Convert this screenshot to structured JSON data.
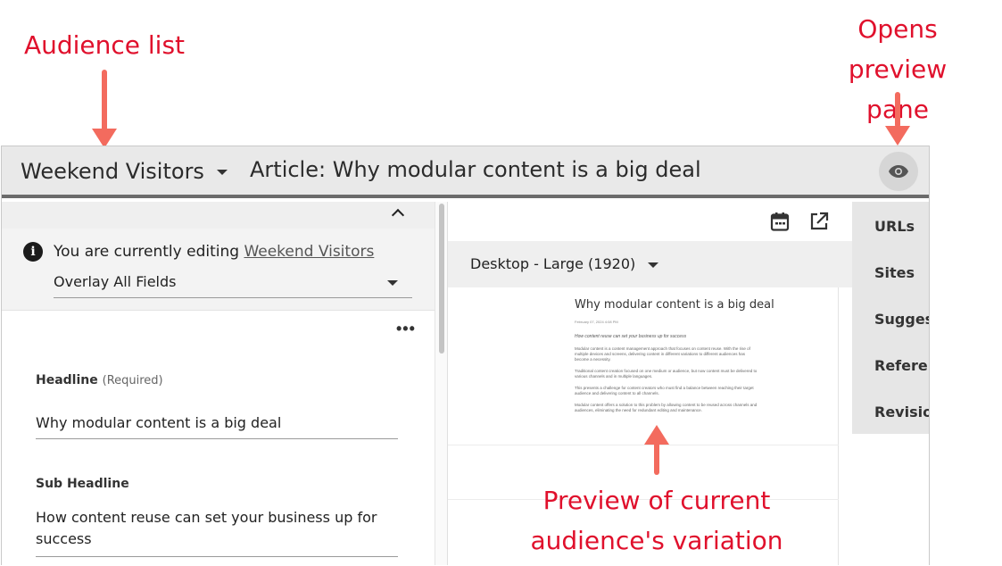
{
  "annotations": {
    "audience_list": "Audience list",
    "opens_preview_line1": "Opens preview",
    "opens_preview_line2": "pane",
    "preview_line1": "Preview of current",
    "preview_line2": "audience's variation"
  },
  "header": {
    "audience": "Weekend Visitors",
    "article_title": "Article: Why modular content is a big deal",
    "preview_icon": "eye-icon"
  },
  "editor": {
    "editing_prefix": "You are currently editing",
    "editing_audience": "Weekend Visitors",
    "overlay_mode": "Overlay All Fields",
    "more_label": "•••",
    "fields": [
      {
        "label": "Headline",
        "note": "(Required)",
        "value": "Why modular content is a big deal"
      },
      {
        "label": "Sub Headline",
        "value": "How content reuse can set your business up for success"
      }
    ]
  },
  "preview": {
    "device": "Desktop - Large (1920)",
    "icons": [
      "calendar-icon",
      "open-external-icon"
    ],
    "article": {
      "title": "Why modular content is a big deal",
      "date": "February 07, 2024 4:08 PM",
      "subtitle": "How content reuse can set your business up for success",
      "paragraphs": [
        "Modular content is a content management approach that focuses on content reuse. With the rise of multiple devices and screens, delivering content in different variations to different audiences has become a necessity.",
        "Traditional content creation focused on one medium or audience, but now content must be delivered to various channels and in multiple languages.",
        "This presents a challenge for content creators who must find a balance between reaching their target audience and delivering content to all channels.",
        "Modular content offers a solution to this problem by allowing content to be reused across channels and audiences, eliminating the need for redundant editing and maintenance."
      ]
    }
  },
  "rail": {
    "items": [
      "URLs",
      "Sites",
      "Suggestions",
      "References",
      "Revisions"
    ]
  },
  "colors": {
    "annotation": "#e0102c",
    "arrow": "#f36b5e",
    "header_bg": "#e9e9e9",
    "header_border": "#6b6b6b"
  }
}
